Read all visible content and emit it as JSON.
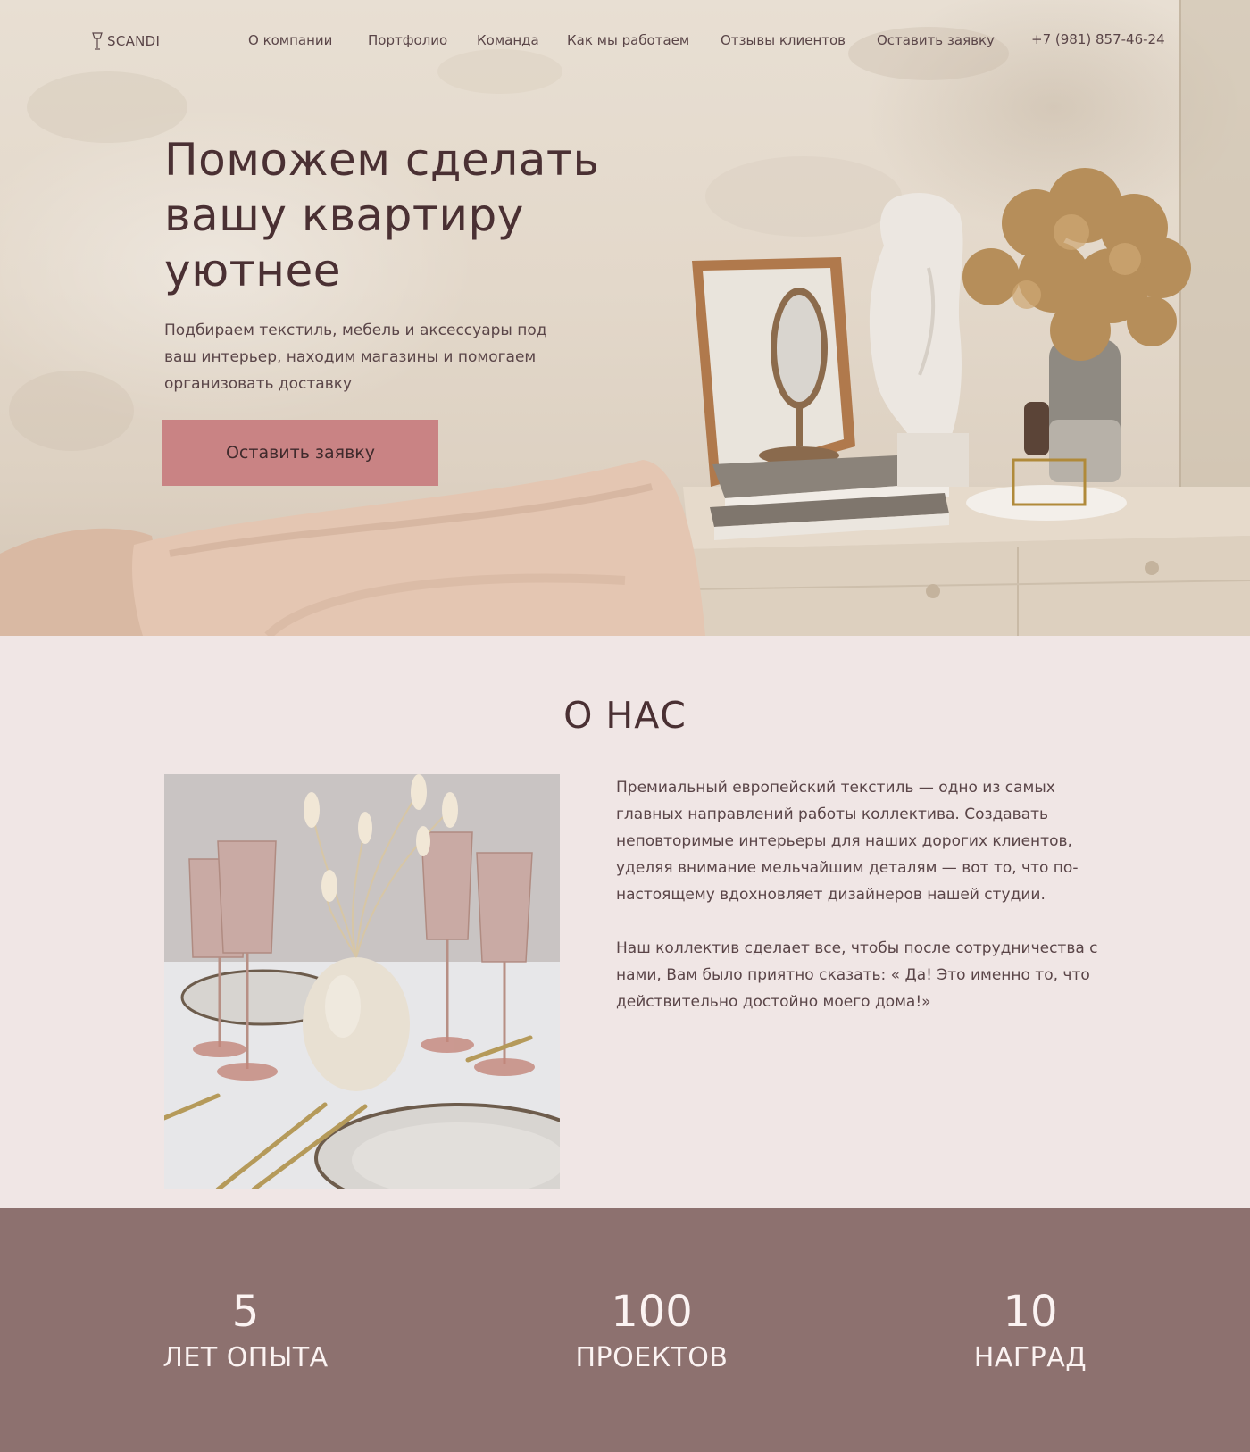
{
  "header": {
    "logo_text": "SCANDI",
    "nav": [
      "О компании",
      "Портфолио",
      "Команда",
      "Как мы работаем",
      "Отзывы клиентов",
      "Оставить заявку"
    ],
    "phone": "+7 (981) 857-46-24"
  },
  "hero": {
    "title": "Поможем сделать вашу квартиру уютнее",
    "subtitle": "Подбираем текстиль, мебель и аксессуары под ваш интерьер, находим магазины и помогаем организовать доставку",
    "cta_label": "Оставить заявку"
  },
  "about": {
    "title": "О НАС",
    "paragraph_1": "Премиальный европейский текстиль — одно из самых главных направлений работы коллектива. Создавать неповторимые интерьеры для наших дорогих клиентов, уделяя внимание мельчайшим деталям — вот то,  что по-настоящему вдохновляет дизайнеров нашей студии.",
    "paragraph_2": "Наш коллектив сделает все, чтобы после сотрудничества с нами,  Вам было приятно сказать: « Да! Это именно то, что действительно достойно моего дома!»"
  },
  "stats": [
    {
      "value": "5",
      "label": "ЛЕТ ОПЫТА"
    },
    {
      "value": "100",
      "label": "ПРОЕКТОВ"
    },
    {
      "value": "10",
      "label": "НАГРАД"
    }
  ],
  "colors": {
    "accent_button": "#c98384",
    "stats_background": "#8d716f",
    "about_background": "#f0e6e5",
    "text_dark": "#4a3033"
  }
}
